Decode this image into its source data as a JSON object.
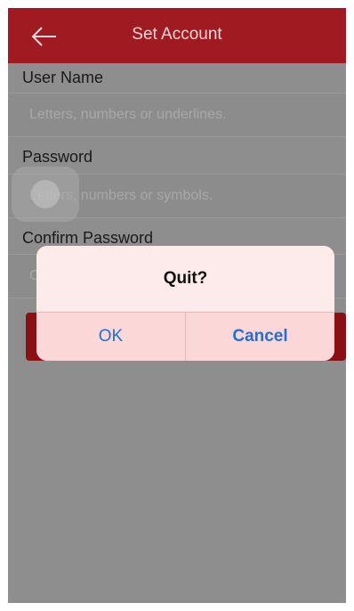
{
  "header": {
    "title": "Set Account",
    "back_icon": "arrow-left-icon"
  },
  "form": {
    "username": {
      "label": "User Name",
      "placeholder": "Letters, numbers or underlines.",
      "value": ""
    },
    "password": {
      "label": "Password",
      "placeholder": "Letters, numbers or symbols.",
      "value": ""
    },
    "confirm_password": {
      "label": "Confirm Password",
      "value_visible": "C"
    }
  },
  "dialog": {
    "title": "Quit?",
    "ok_label": "OK",
    "cancel_label": "Cancel"
  },
  "colors": {
    "header_bg": "#a01a21",
    "accent_button": "#8a1016",
    "dialog_button_text": "#1f6fd6"
  }
}
